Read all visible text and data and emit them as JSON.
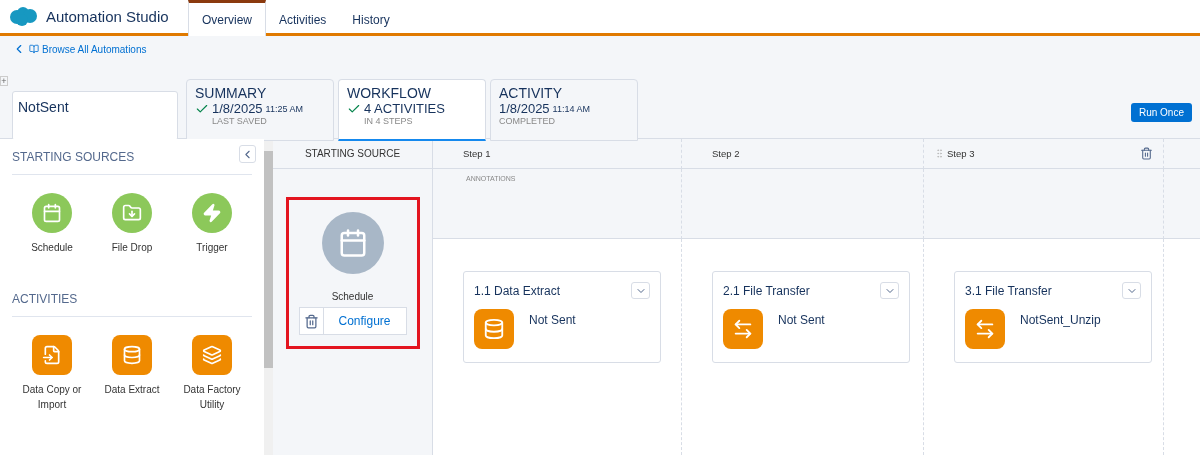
{
  "app": {
    "title": "Automation Studio"
  },
  "tabs": [
    {
      "label": "Overview",
      "selected": true
    },
    {
      "label": "Activities",
      "selected": false
    },
    {
      "label": "History",
      "selected": false
    }
  ],
  "breadcrumb": {
    "label": "Browse All Automations"
  },
  "expand_button": "+",
  "automation_name": "NotSent",
  "summary_cards": [
    {
      "title": "SUMMARY",
      "checked": true,
      "value": "1/8/2025",
      "time": "11:25 AM",
      "caption": "LAST SAVED",
      "selected": false
    },
    {
      "title": "WORKFLOW",
      "checked": true,
      "value": "4 ACTIVITIES",
      "caption": "IN 4 STEPS",
      "selected": true
    },
    {
      "title": "ACTIVITY",
      "checked": false,
      "value": "1/8/2025",
      "time": "11:14 AM",
      "caption": "COMPLETED",
      "selected": false
    }
  ],
  "run_button": "Run Once",
  "sidebar": {
    "sections": [
      {
        "title": "STARTING SOURCES",
        "kind": "source",
        "items": [
          {
            "label": "Schedule",
            "kind": "schedule"
          },
          {
            "label": "File Drop",
            "kind": "filedrop"
          },
          {
            "label": "Trigger",
            "kind": "trigger"
          }
        ]
      },
      {
        "title": "ACTIVITIES",
        "kind": "activity",
        "items": [
          {
            "label": "Data Copy or Import",
            "kind": "import"
          },
          {
            "label": "Data Extract",
            "kind": "extract"
          },
          {
            "label": "Data Factory Utility",
            "kind": "factory"
          }
        ]
      }
    ]
  },
  "canvas": {
    "source_column": {
      "header": "STARTING SOURCE",
      "source": {
        "label": "Schedule",
        "action": "Configure",
        "highlighted": true
      }
    },
    "annotations_label": "ANNOTATIONS",
    "steps": [
      {
        "header": "Step 1",
        "hovered": false,
        "activities": [
          {
            "title": "1.1 Data Extract",
            "name": "Not Sent",
            "kind": "extract"
          }
        ]
      },
      {
        "header": "Step 2",
        "hovered": false,
        "activities": [
          {
            "title": "2.1 File Transfer",
            "name": "Not Sent",
            "kind": "transfer"
          }
        ]
      },
      {
        "header": "Step 3",
        "hovered": true,
        "activities": [
          {
            "title": "3.1 File Transfer",
            "name": "NotSent_Unzip",
            "kind": "transfer"
          }
        ]
      }
    ]
  }
}
